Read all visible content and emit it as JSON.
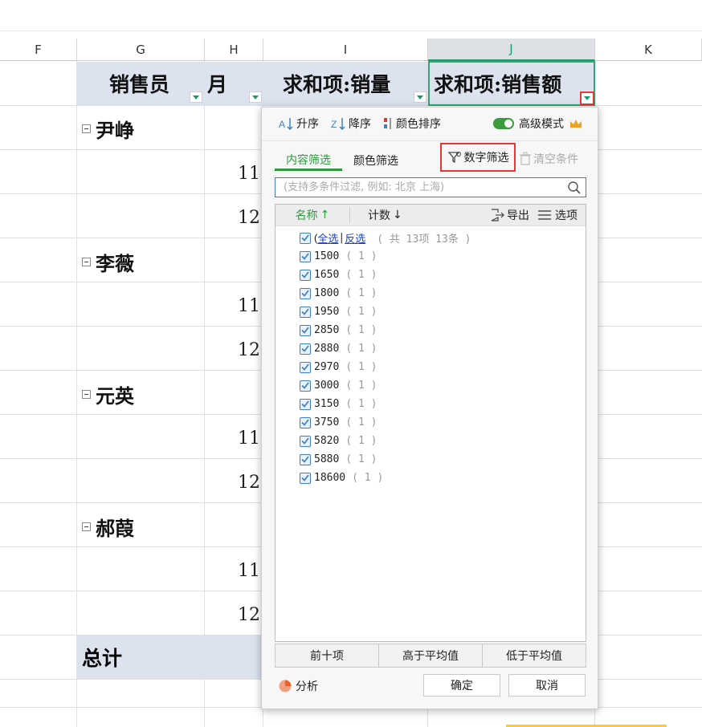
{
  "columns": [
    "F",
    "G",
    "H",
    "I",
    "J",
    "K"
  ],
  "pivot_headers": {
    "salesperson": "销售员",
    "month": "月",
    "sum_qty": "求和项:销量",
    "sum_amount": "求和项:销售额"
  },
  "groups": [
    {
      "name": "尹峥",
      "months": [
        "11",
        "12"
      ]
    },
    {
      "name": "李薇",
      "months": [
        "11",
        "12"
      ]
    },
    {
      "name": "元英",
      "months": [
        "11",
        "12"
      ]
    },
    {
      "name": "郝葭",
      "months": [
        "11",
        "12"
      ]
    }
  ],
  "total_label": "总计",
  "filter": {
    "sort_asc": "升序",
    "sort_desc": "降序",
    "color_sort": "颜色排序",
    "advanced_mode": "高级模式",
    "tab_content": "内容筛选",
    "tab_color": "颜色筛选",
    "number_filter": "数字筛选",
    "clear_conditions": "清空条件",
    "search_placeholder": "(支持多条件过滤, 例如: 北京 上海)",
    "col_name": "名称",
    "col_count": "计数",
    "export": "导出",
    "options": "选项",
    "select_all": {
      "open": "(",
      "all": "全选",
      "invert": "反选",
      "summary": "( 共 13项 13条 )"
    },
    "items": [
      {
        "value": "1500",
        "count": "( 1 )"
      },
      {
        "value": "1650",
        "count": "( 1 )"
      },
      {
        "value": "1800",
        "count": "( 1 )"
      },
      {
        "value": "1950",
        "count": "( 1 )"
      },
      {
        "value": "2850",
        "count": "( 1 )"
      },
      {
        "value": "2880",
        "count": "( 1 )"
      },
      {
        "value": "2970",
        "count": "( 1 )"
      },
      {
        "value": "3000",
        "count": "( 1 )"
      },
      {
        "value": "3150",
        "count": "( 1 )"
      },
      {
        "value": "3750",
        "count": "( 1 )"
      },
      {
        "value": "5820",
        "count": "( 1 )"
      },
      {
        "value": "5880",
        "count": "( 1 )"
      },
      {
        "value": "18600",
        "count": "( 1 )"
      }
    ],
    "top_ten": "前十项",
    "above_avg": "高于平均值",
    "below_avg": "低于平均值",
    "analysis": "分析",
    "ok": "确定",
    "cancel": "取消"
  },
  "colors": {
    "accent": "#2e9b3d",
    "highlight": "#e53935",
    "header_bg": "#dce3ef"
  }
}
